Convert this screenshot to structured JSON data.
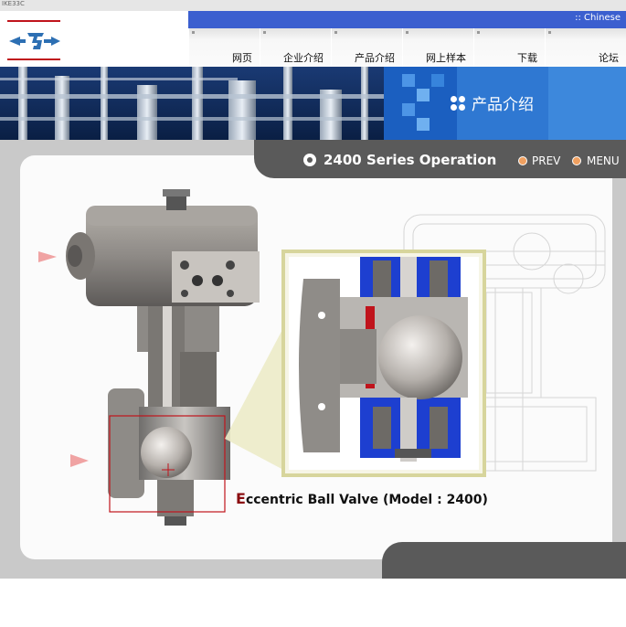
{
  "window": {
    "caption": "IKE33C"
  },
  "header": {
    "language_link": ":: Chinese",
    "nav": [
      "网页",
      "企业介绍",
      "产品介绍",
      "网上样本",
      "下载",
      "论坛"
    ]
  },
  "banner": {
    "title": "产品介绍"
  },
  "content": {
    "title": "2400 Series Operation",
    "prev_label": "PREV",
    "menu_label": "MENU",
    "caption_first": "E",
    "caption_rest": "ccentric Ball Valve (Model : 2400)"
  },
  "colors": {
    "brand_blue": "#3b5fcf",
    "banner_navy": "#0e2a5a",
    "band_gray": "#5a5a5a",
    "cutaway_blue": "#1d3fd0",
    "accent_red": "#c0141c"
  }
}
